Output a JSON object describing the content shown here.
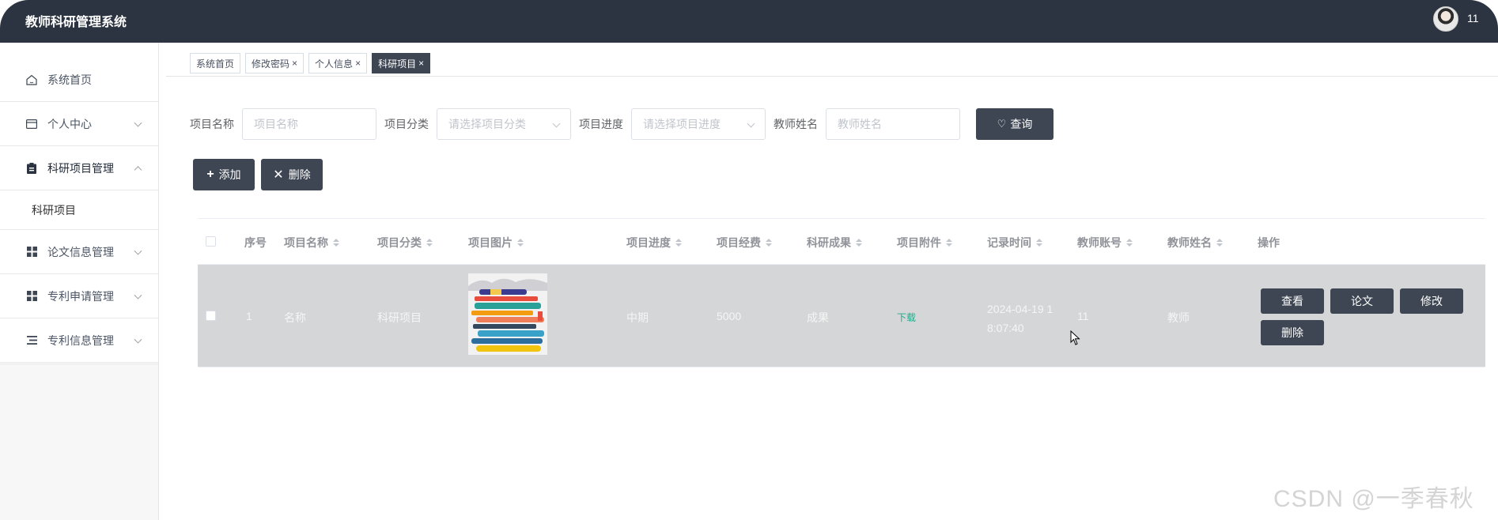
{
  "app": {
    "title": "教师科研管理系统",
    "username": "11"
  },
  "sidebar": {
    "home": "系统首页",
    "items": [
      {
        "label": "个人中心"
      },
      {
        "label": "科研项目管理"
      },
      {
        "label": "论文信息管理"
      },
      {
        "label": "专利申请管理"
      },
      {
        "label": "专利信息管理"
      }
    ],
    "submenu": "科研项目"
  },
  "tabs": [
    {
      "label": "系统首页",
      "closable": false
    },
    {
      "label": "修改密码",
      "closable": true
    },
    {
      "label": "个人信息",
      "closable": true
    },
    {
      "label": "科研项目",
      "closable": true,
      "active": true
    }
  ],
  "search": {
    "name_label": "项目名称",
    "name_placeholder": "项目名称",
    "category_label": "项目分类",
    "category_placeholder": "请选择项目分类",
    "progress_label": "项目进度",
    "progress_placeholder": "请选择项目进度",
    "teacher_label": "教师姓名",
    "teacher_placeholder": "教师姓名",
    "query_button": "查询"
  },
  "actions": {
    "add": "添加",
    "delete": "删除"
  },
  "table": {
    "headers": [
      "序号",
      "项目名称",
      "项目分类",
      "项目图片",
      "项目进度",
      "项目经费",
      "科研成果",
      "项目附件",
      "记录时间",
      "教师账号",
      "教师姓名",
      "操作"
    ],
    "rows": [
      {
        "index": "1",
        "name": "名称",
        "category": "科研项目",
        "progress": "中期",
        "funding": "5000",
        "result": "成果",
        "attachment": "下载",
        "time": "2024-04-19 18:07:40",
        "account": "11",
        "teacher": "教师",
        "buttons": {
          "view": "查看",
          "paper": "论文",
          "edit": "修改",
          "delete": "删除"
        }
      }
    ]
  },
  "watermark": "CSDN @一季春秋"
}
